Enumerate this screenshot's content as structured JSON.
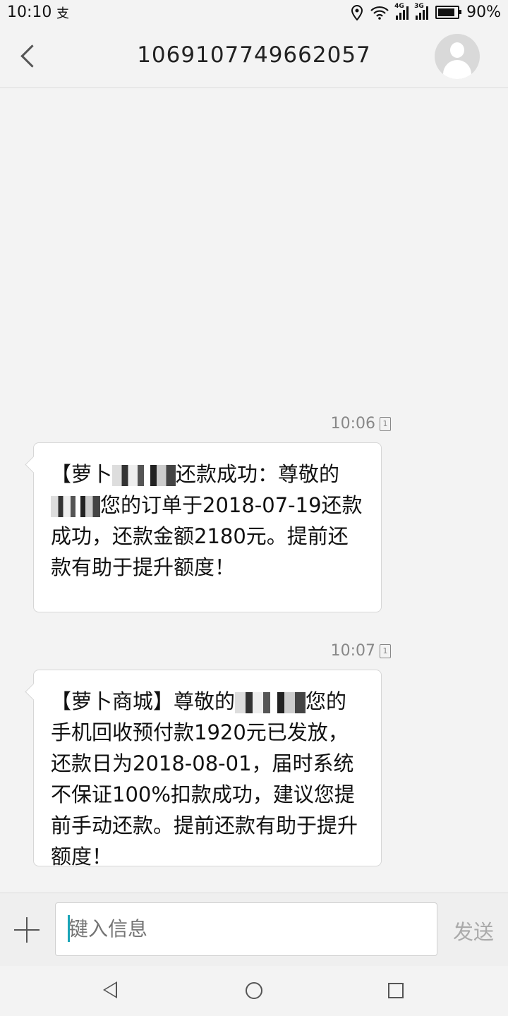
{
  "status_bar": {
    "time": "10:10",
    "app_icon": "支",
    "net1": "4G",
    "net2": "3G",
    "battery": "90%",
    "battery_level": 0.9
  },
  "header": {
    "title": "1069107749662057"
  },
  "messages": [
    {
      "time": "10:06",
      "sim": "1",
      "parts": [
        "【萝卜",
        "",
        "还款成功：尊敬的",
        "",
        "您的订单于2018-07-19还款成功，还款金额2180元。提前还款有助于提升额度！"
      ]
    },
    {
      "time": "10:07",
      "sim": "1",
      "parts": [
        "【萝卜商城】尊敬的",
        "",
        "您的手机回收预付款1920元已发放，还款日为2018-08-01，届时系统不保证100%扣款成功，建议您提前手动还款。提前还款有助于提升额度！"
      ]
    }
  ],
  "input": {
    "placeholder": "键入信息",
    "send_label": "发送"
  },
  "colors": {
    "accent": "#1aa5b8",
    "bubble_bg": "#ffffff",
    "page_bg": "#f3f3f3"
  }
}
